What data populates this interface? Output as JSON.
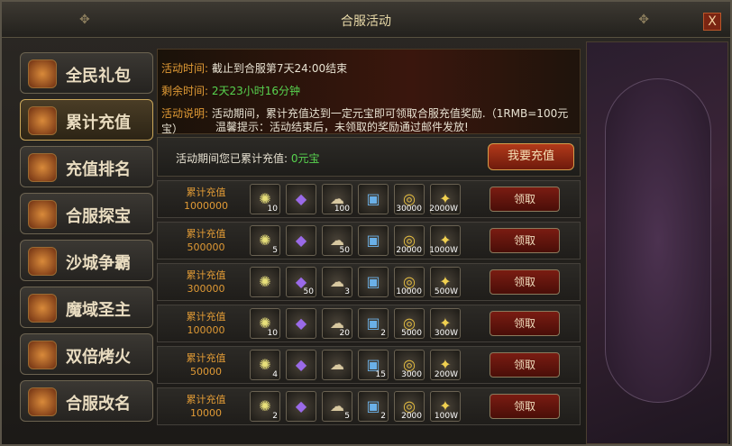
{
  "window": {
    "title": "合服活动",
    "close_label": "X"
  },
  "sidebar": {
    "items": [
      {
        "label": "全民礼包"
      },
      {
        "label": "累计充值",
        "active": true
      },
      {
        "label": "充值排名"
      },
      {
        "label": "合服探宝"
      },
      {
        "label": "沙城争霸"
      },
      {
        "label": "魔域圣主"
      },
      {
        "label": "双倍烤火"
      },
      {
        "label": "合服改名"
      }
    ]
  },
  "info": {
    "time_key": "活动时间:",
    "time_value": "截止到合服第7天24:00结束",
    "remain_key": "剩余时间:",
    "remain_value": "2天23小时16分钟",
    "desc_key": "活动说明:",
    "desc_value": "活动期间，累计充值达到一定元宝即可领取合服充值奖励.（1RMB=100元宝）",
    "tip": "温馨提示：活动结束后，未领取的奖励通过邮件发放!"
  },
  "summary": {
    "text": "活动期间您已累计充值:",
    "amount": "0元宝",
    "recharge_button": "我要充值"
  },
  "rows": [
    {
      "label": "累计充值",
      "amount": "1000000",
      "claim": "领取",
      "counts": [
        "10",
        "",
        "100",
        "",
        "30000",
        "2000W"
      ]
    },
    {
      "label": "累计充值",
      "amount": "500000",
      "claim": "领取",
      "counts": [
        "5",
        "",
        "50",
        "",
        "20000",
        "1000W"
      ]
    },
    {
      "label": "累计充值",
      "amount": "300000",
      "claim": "领取",
      "counts": [
        "",
        "50",
        "3",
        "",
        "10000",
        "500W"
      ]
    },
    {
      "label": "累计充值",
      "amount": "100000",
      "claim": "领取",
      "counts": [
        "10",
        "",
        "20",
        "2",
        "5000",
        "300W"
      ]
    },
    {
      "label": "累计充值",
      "amount": "50000",
      "claim": "领取",
      "counts": [
        "4",
        "",
        "",
        "15",
        "3000",
        "200W"
      ]
    },
    {
      "label": "累计充值",
      "amount": "10000",
      "claim": "领取",
      "counts": [
        "2",
        "",
        "5",
        "2",
        "2000",
        "100W"
      ]
    }
  ]
}
